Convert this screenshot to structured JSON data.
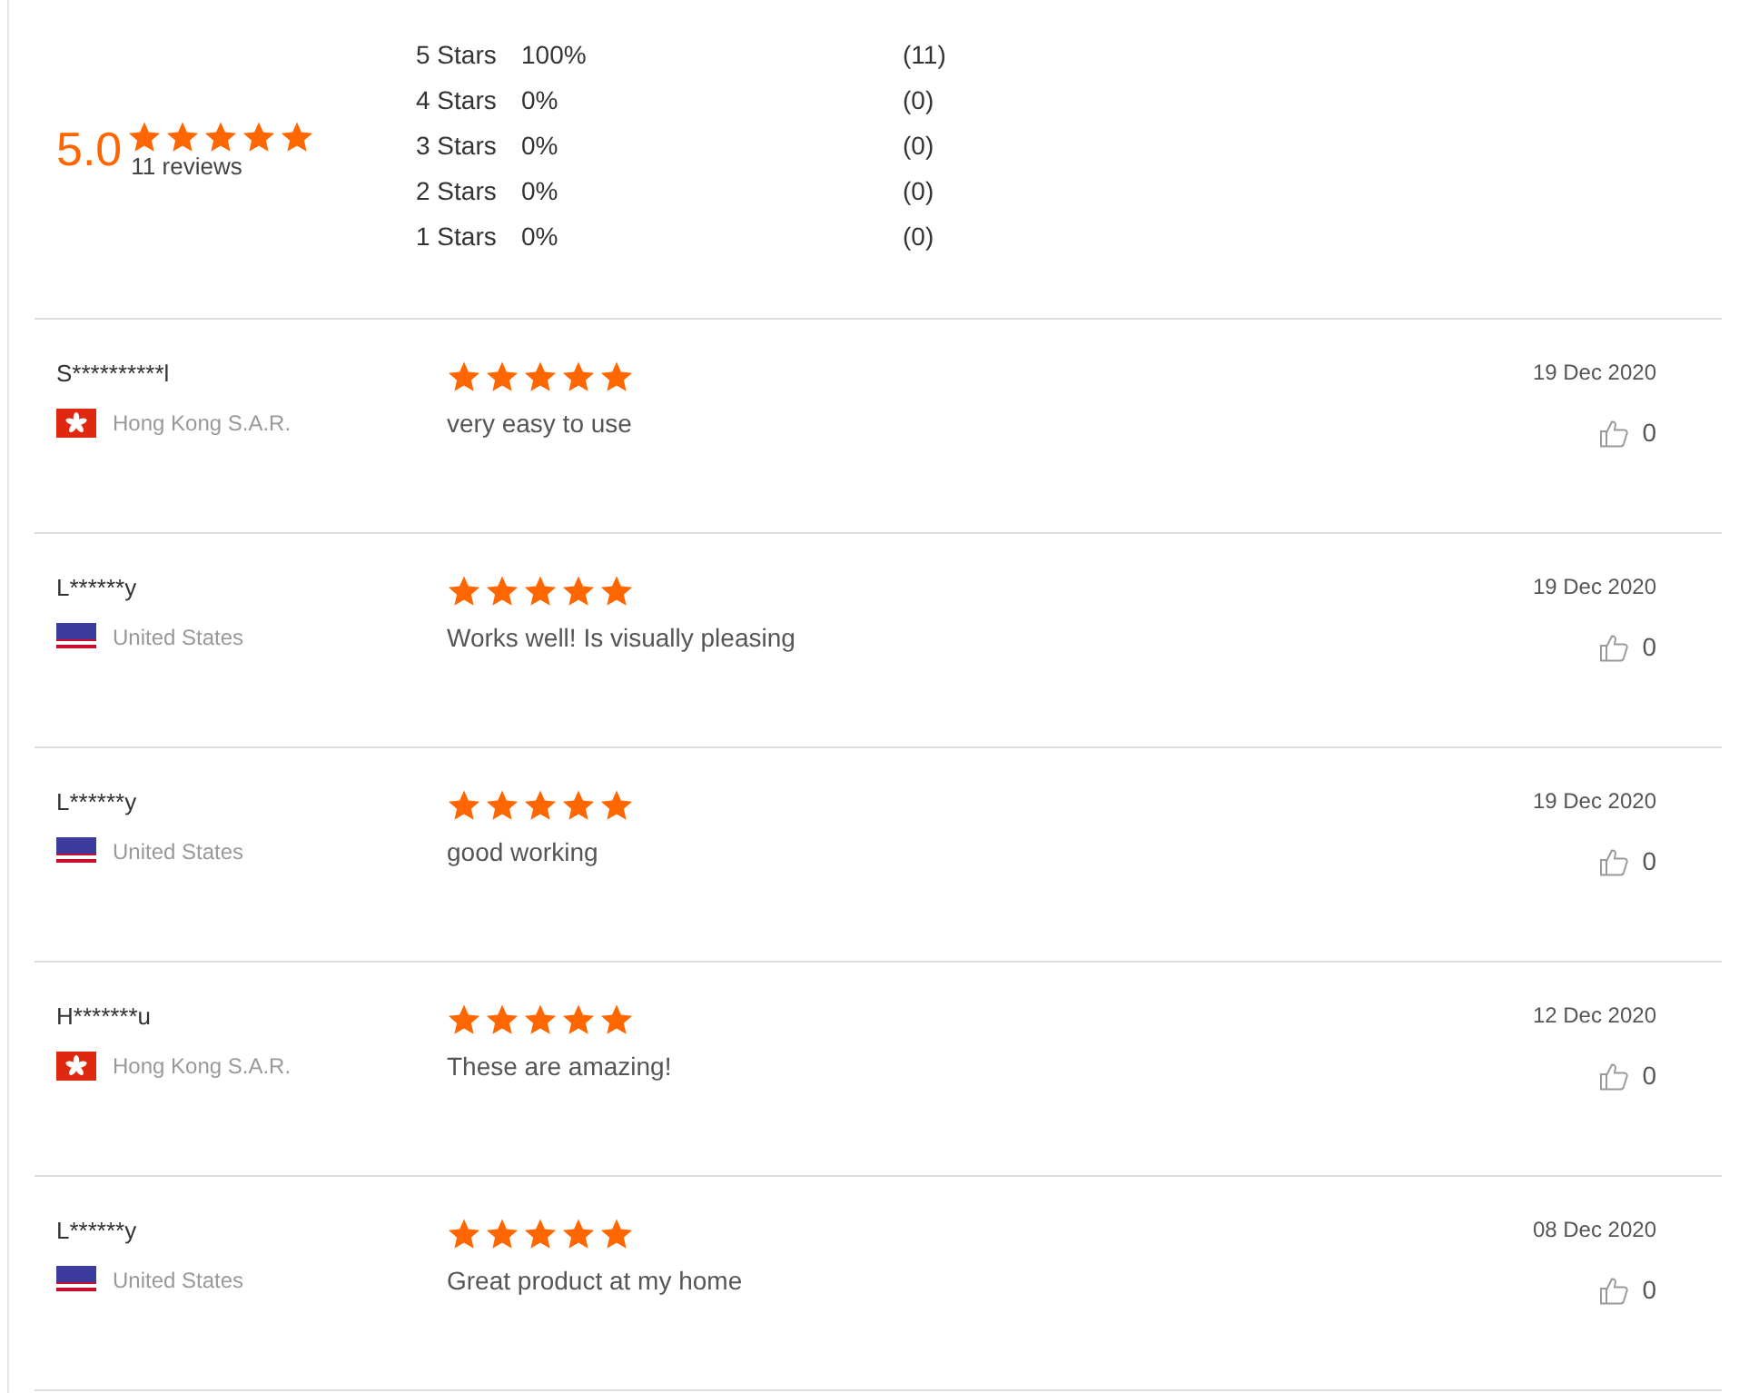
{
  "summary": {
    "rating": "5.0",
    "stars": 5,
    "count": "11 reviews",
    "breakdown": [
      {
        "label": "5 Stars",
        "percent": "100%",
        "count": "(11)"
      },
      {
        "label": "4 Stars",
        "percent": "0%",
        "count": "(0)"
      },
      {
        "label": "3 Stars",
        "percent": "0%",
        "count": "(0)"
      },
      {
        "label": "2 Stars",
        "percent": "0%",
        "count": "(0)"
      },
      {
        "label": "1 Stars",
        "percent": "0%",
        "count": "(0)"
      }
    ]
  },
  "reviews": [
    {
      "name": "S**********l",
      "kind": "hk",
      "country": "Hong Kong S.A.R.",
      "stars": 5,
      "text": "very easy to use",
      "date": "19 Dec 2020",
      "likes": "0"
    },
    {
      "name": "L******y",
      "kind": "us",
      "country": "United States",
      "stars": 5,
      "text": "Works well! Is visually pleasing",
      "date": "19 Dec 2020",
      "likes": "0"
    },
    {
      "name": "L******y",
      "kind": "us",
      "country": "United States",
      "stars": 5,
      "text": "good working",
      "date": "19 Dec 2020",
      "likes": "0"
    },
    {
      "name": "H*******u",
      "kind": "hk",
      "country": "Hong Kong S.A.R.",
      "stars": 5,
      "text": "These are amazing!",
      "date": "12 Dec 2020",
      "likes": "0"
    },
    {
      "name": "L******y",
      "kind": "us",
      "country": "United States",
      "stars": 5,
      "text": "Great product at my home",
      "date": "08 Dec 2020",
      "likes": "0"
    }
  ]
}
